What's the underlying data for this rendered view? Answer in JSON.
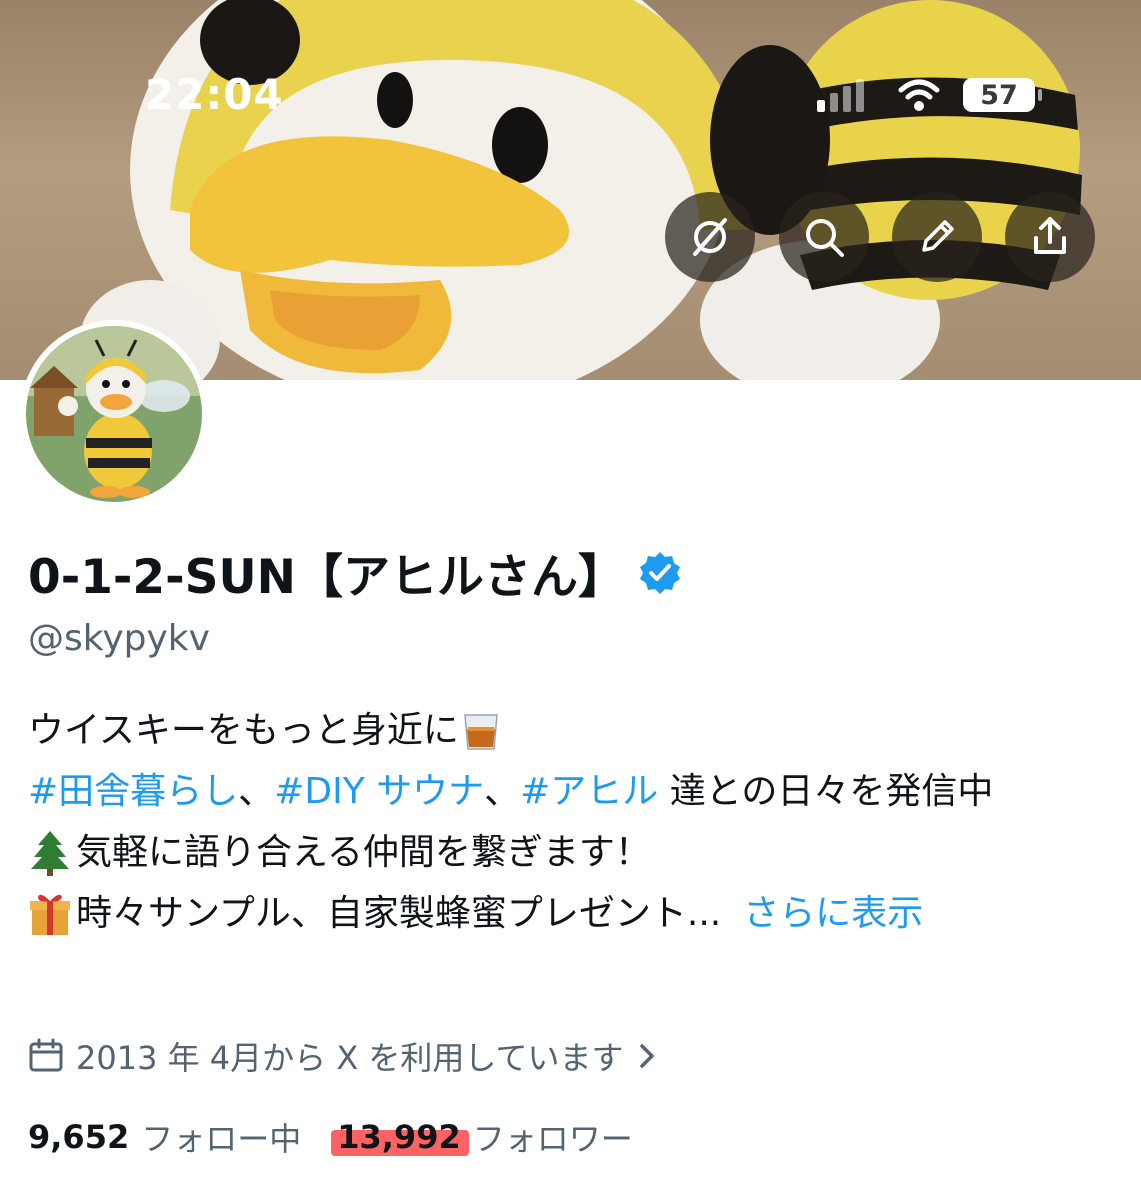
{
  "status_bar": {
    "time": "22:04",
    "battery": "57"
  },
  "banner": {
    "buttons": [
      "grok-icon",
      "search-icon",
      "edit-icon",
      "share-icon"
    ]
  },
  "profile": {
    "display_name": "0-1-2-SUN【アヒルさん】",
    "verified": true,
    "handle": "@skypykv",
    "bio": {
      "line1_text": "ウイスキーをもっと身近に",
      "line2_tags": [
        "#田舎暮らし",
        "#DIY サウナ",
        "#アヒル"
      ],
      "line2_separator": "、",
      "line2_suffix": " 達との日々を発信中",
      "line3_text": "気軽に語り合える仲間を繋ぎます！",
      "line4_text": "時々サンプル、自家製蜂蜜プレゼント...",
      "show_more": "さらに表示"
    },
    "joined": "2013 年 4月から X を利用しています",
    "following_count": "9,652",
    "following_label": "フォロー中",
    "followers_count": "13,992",
    "followers_label": "フォロワー"
  },
  "colors": {
    "accent": "#1d9bf0",
    "text": "#0f1419",
    "secondary": "#536471",
    "highlight": "#ff3b3b"
  }
}
